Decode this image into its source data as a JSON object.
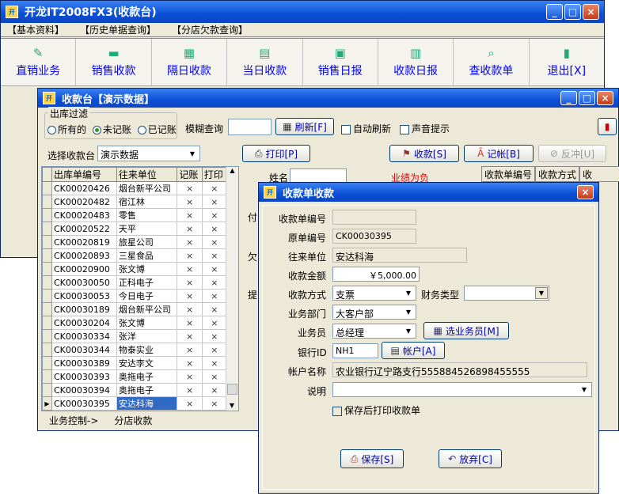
{
  "main_window": {
    "title": "开龙IT2008FX3(收款台)",
    "menu": [
      "【基本资料】",
      "【历史单据查询】",
      "【分店欠款查询】"
    ],
    "toolbar": [
      {
        "label": "直销业务",
        "icon": "pen-icon"
      },
      {
        "label": "销售收款",
        "icon": "money-icon"
      },
      {
        "label": "隔日收款",
        "icon": "book-icon"
      },
      {
        "label": "当日收款",
        "icon": "cash-icon"
      },
      {
        "label": "销售日报",
        "icon": "report-icon"
      },
      {
        "label": "收款日报",
        "icon": "daily-icon"
      },
      {
        "label": "查收款单",
        "icon": "search-icon"
      },
      {
        "label": "退出[X]",
        "icon": "exit-icon"
      }
    ]
  },
  "cashier": {
    "title": "收款台【演示数据】",
    "filter_group": "出库过滤",
    "radios": [
      "所有的",
      "未记账",
      "已记账"
    ],
    "fuzzy_label": "模糊查询",
    "refresh": "刷新[F]",
    "auto_refresh": "自动刷新",
    "sound": "声音提示",
    "select_label": "选择收款台",
    "select_value": "演示数据",
    "print": "打印[P]",
    "receive": "收款[S]",
    "post": "记帐[B]",
    "reverse": "反冲[U]",
    "cols": [
      "出库单编号",
      "往来单位",
      "记账",
      "打印"
    ],
    "rows": [
      {
        "no": "CK00020426",
        "unit": "烟台新平公司"
      },
      {
        "no": "CK00020482",
        "unit": "宿江林"
      },
      {
        "no": "CK00020483",
        "unit": "零售"
      },
      {
        "no": "CK00020522",
        "unit": "天平"
      },
      {
        "no": "CK00020819",
        "unit": "旅星公司"
      },
      {
        "no": "CK00020893",
        "unit": "三星食品"
      },
      {
        "no": "CK00020900",
        "unit": "张文博"
      },
      {
        "no": "CK00030050",
        "unit": "正科电子"
      },
      {
        "no": "CK00030053",
        "unit": "今日电子"
      },
      {
        "no": "CK00030189",
        "unit": "烟台新平公司"
      },
      {
        "no": "CK00030204",
        "unit": "张文博"
      },
      {
        "no": "CK00030334",
        "unit": "张洋"
      },
      {
        "no": "CK00030344",
        "unit": "物泰实业"
      },
      {
        "no": "CK00030389",
        "unit": "安达李文"
      },
      {
        "no": "CK00030393",
        "unit": "奥拖电子"
      },
      {
        "no": "CK00030394",
        "unit": "奥拖电子"
      },
      {
        "no": "CK00030395",
        "unit": "安达科海"
      }
    ],
    "x_mark": "×",
    "right_name": "姓名",
    "right_red": "业绩为负",
    "right_cols": [
      "收款单编号",
      "收款方式",
      "收"
    ],
    "side_labels": [
      "付",
      "欠",
      "提"
    ],
    "status": [
      "业务控制->",
      "分店收款"
    ]
  },
  "dialog": {
    "title": "收款单收款",
    "labels": {
      "receipt_no": "收款单编号",
      "orig_no": "原单编号",
      "unit": "往来单位",
      "amount": "收款金额",
      "method": "收款方式",
      "fin_type": "财务类型",
      "dept": "业务部门",
      "clerk": "业务员",
      "bank_id": "银行ID",
      "acct_name": "帐户名称",
      "note": "说明"
    },
    "values": {
      "receipt_no": "",
      "orig_no": "CK00030395",
      "unit": "安达科海",
      "amount": "￥5,000.00",
      "method": "支票",
      "fin_type": "",
      "dept": "大客户部",
      "clerk": "总经理",
      "bank_id": "NH1",
      "acct_name": "农业银行辽宁路支行555884526898455555",
      "note": ""
    },
    "select_clerk": "选业务员[M]",
    "account_btn": "帐户[A]",
    "print_after": "保存后打印收款单",
    "save": "保存[S]",
    "cancel": "放弃[C]"
  }
}
